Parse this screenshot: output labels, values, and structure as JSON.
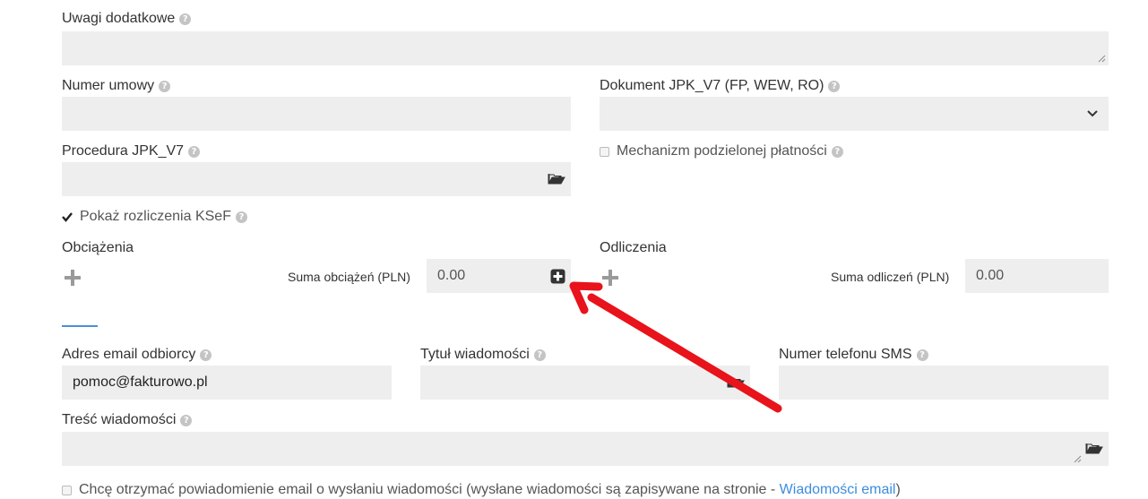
{
  "form": {
    "uwagi": {
      "label": "Uwagi dodatkowe",
      "value": ""
    },
    "numer_umowy": {
      "label": "Numer umowy",
      "value": ""
    },
    "dokument_jpk": {
      "label": "Dokument JPK_V7 (FP, WEW, RO)",
      "selected": ""
    },
    "procedura_jpk": {
      "label": "Procedura JPK_V7",
      "value": ""
    },
    "mechanizm": {
      "label": "Mechanizm podzielonej płatności",
      "checked": false
    },
    "ksef": {
      "label": "Pokaż rozliczenia KSeF",
      "checked": true
    },
    "obciazenia": {
      "title": "Obciążenia",
      "sum_label": "Suma obciążeń (PLN)",
      "sum_value": "0.00"
    },
    "odliczenia": {
      "title": "Odliczenia",
      "sum_label": "Suma odliczeń (PLN)",
      "sum_value": "0.00"
    },
    "email": {
      "label": "Adres email odbiorcy",
      "value": "pomoc@fakturowo.pl"
    },
    "tytul": {
      "label": "Tytuł wiadomości",
      "value": ""
    },
    "sms": {
      "label": "Numer telefonu SMS",
      "value": ""
    },
    "tresc": {
      "label": "Treść wiadomości",
      "value": ""
    },
    "notify": {
      "label": "Chcę otrzymać powiadomienie email o wysłaniu wiadomości (wysłane wiadomości są zapisywane na stronie - ",
      "link": "Wiadomości email",
      "suffix": ")",
      "checked": false
    }
  },
  "help_glyph": "?",
  "icons": {
    "help": "question-circle-icon",
    "chevron": "chevron-down-icon",
    "folder": "folder-open-icon",
    "plus": "plus-icon",
    "plus_square": "plus-square-icon",
    "resize": "resize-handle-icon",
    "annotation": "red-arrow-annotation"
  },
  "colors": {
    "field_bg": "#eeeeee",
    "accent": "#4a90d9",
    "link": "#3c8dde",
    "annotation": "#e8131b"
  }
}
